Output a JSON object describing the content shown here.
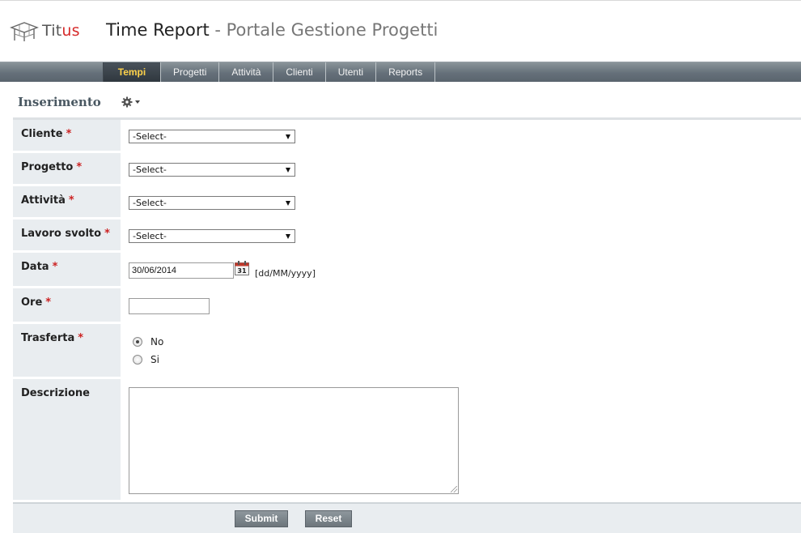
{
  "brand": {
    "name_part1": "Tit",
    "name_part2": "us"
  },
  "app": {
    "title": "Time Report",
    "separator": "-",
    "subtitle": "Portale Gestione Progetti"
  },
  "nav": {
    "tabs": [
      {
        "label": "Tempi",
        "active": true
      },
      {
        "label": "Progetti"
      },
      {
        "label": "Attività"
      },
      {
        "label": "Clienti"
      },
      {
        "label": "Utenti"
      },
      {
        "label": "Reports"
      }
    ]
  },
  "section": {
    "title": "Inserimento",
    "settings_icon": "gear-icon"
  },
  "form": {
    "required_marker": "*",
    "cliente": {
      "label": "Cliente",
      "value": "-Select-"
    },
    "progetto": {
      "label": "Progetto",
      "value": "-Select-"
    },
    "attivita": {
      "label": "Attività",
      "value": "-Select-"
    },
    "lavoro": {
      "label": "Lavoro svolto",
      "value": "-Select-"
    },
    "data": {
      "label": "Data",
      "value": "30/06/2014",
      "calendar_day": "31",
      "format_hint": "[dd/MM/yyyy]"
    },
    "ore": {
      "label": "Ore",
      "value": ""
    },
    "trasferta": {
      "label": "Trasferta",
      "options": [
        {
          "label": "No",
          "checked": true
        },
        {
          "label": "Si",
          "checked": false
        }
      ]
    },
    "descrizione": {
      "label": "Descrizione",
      "value": ""
    }
  },
  "actions": {
    "submit": "Submit",
    "reset": "Reset"
  },
  "colors": {
    "accent_red": "#cc2222",
    "active_tab_text": "#ffd24a",
    "navbar": "#6b757e",
    "label_bg": "#e9edf0"
  }
}
